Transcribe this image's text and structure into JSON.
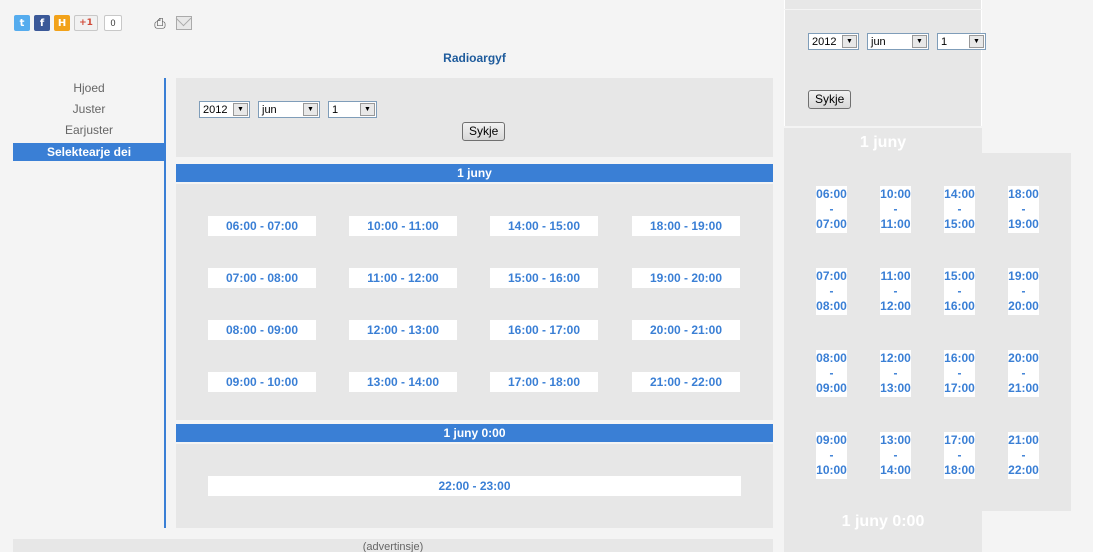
{
  "social": {
    "plus_label": "+1",
    "count": "0"
  },
  "page_title": "Radioargyf",
  "nav": [
    {
      "label": "Hjoed"
    },
    {
      "label": "Juster"
    },
    {
      "label": "Earjuster"
    },
    {
      "label": "Selektearje dei"
    }
  ],
  "date_form": {
    "year": "2012",
    "month": "jun",
    "day": "1",
    "submit": "Sykje"
  },
  "sections": [
    {
      "heading": "1 juny",
      "slots": [
        "06:00 - 07:00",
        "10:00 - 11:00",
        "14:00 - 15:00",
        "18:00 - 19:00",
        "07:00 - 08:00",
        "11:00 - 12:00",
        "15:00 - 16:00",
        "19:00 - 20:00",
        "08:00 - 09:00",
        "12:00 - 13:00",
        "16:00 - 17:00",
        "20:00 - 21:00",
        "09:00 - 10:00",
        "13:00 - 14:00",
        "17:00 - 18:00",
        "21:00 - 22:00"
      ]
    },
    {
      "heading": "1 juny 0:00",
      "slots": [
        "22:00 - 23:00"
      ]
    }
  ],
  "ad_label": "(advertinsje)",
  "right_panel": {
    "form": {
      "year": "2012",
      "month": "jun",
      "day": "1",
      "submit": "Sykje"
    },
    "heading1": "1 juny",
    "heading2": "1 juny 0:00",
    "slots": [
      [
        "06:00",
        "-",
        "07:00"
      ],
      [
        "10:00",
        "-",
        "11:00"
      ],
      [
        "14:00",
        "-",
        "15:00"
      ],
      [
        "18:00",
        "-",
        "19:00"
      ],
      [
        "07:00",
        "-",
        "08:00"
      ],
      [
        "11:00",
        "-",
        "12:00"
      ],
      [
        "15:00",
        "-",
        "16:00"
      ],
      [
        "19:00",
        "-",
        "20:00"
      ],
      [
        "08:00",
        "-",
        "09:00"
      ],
      [
        "12:00",
        "-",
        "13:00"
      ],
      [
        "16:00",
        "-",
        "17:00"
      ],
      [
        "20:00",
        "-",
        "21:00"
      ],
      [
        "09:00",
        "-",
        "10:00"
      ],
      [
        "13:00",
        "-",
        "14:00"
      ],
      [
        "17:00",
        "-",
        "18:00"
      ],
      [
        "21:00",
        "-",
        "22:00"
      ]
    ]
  }
}
